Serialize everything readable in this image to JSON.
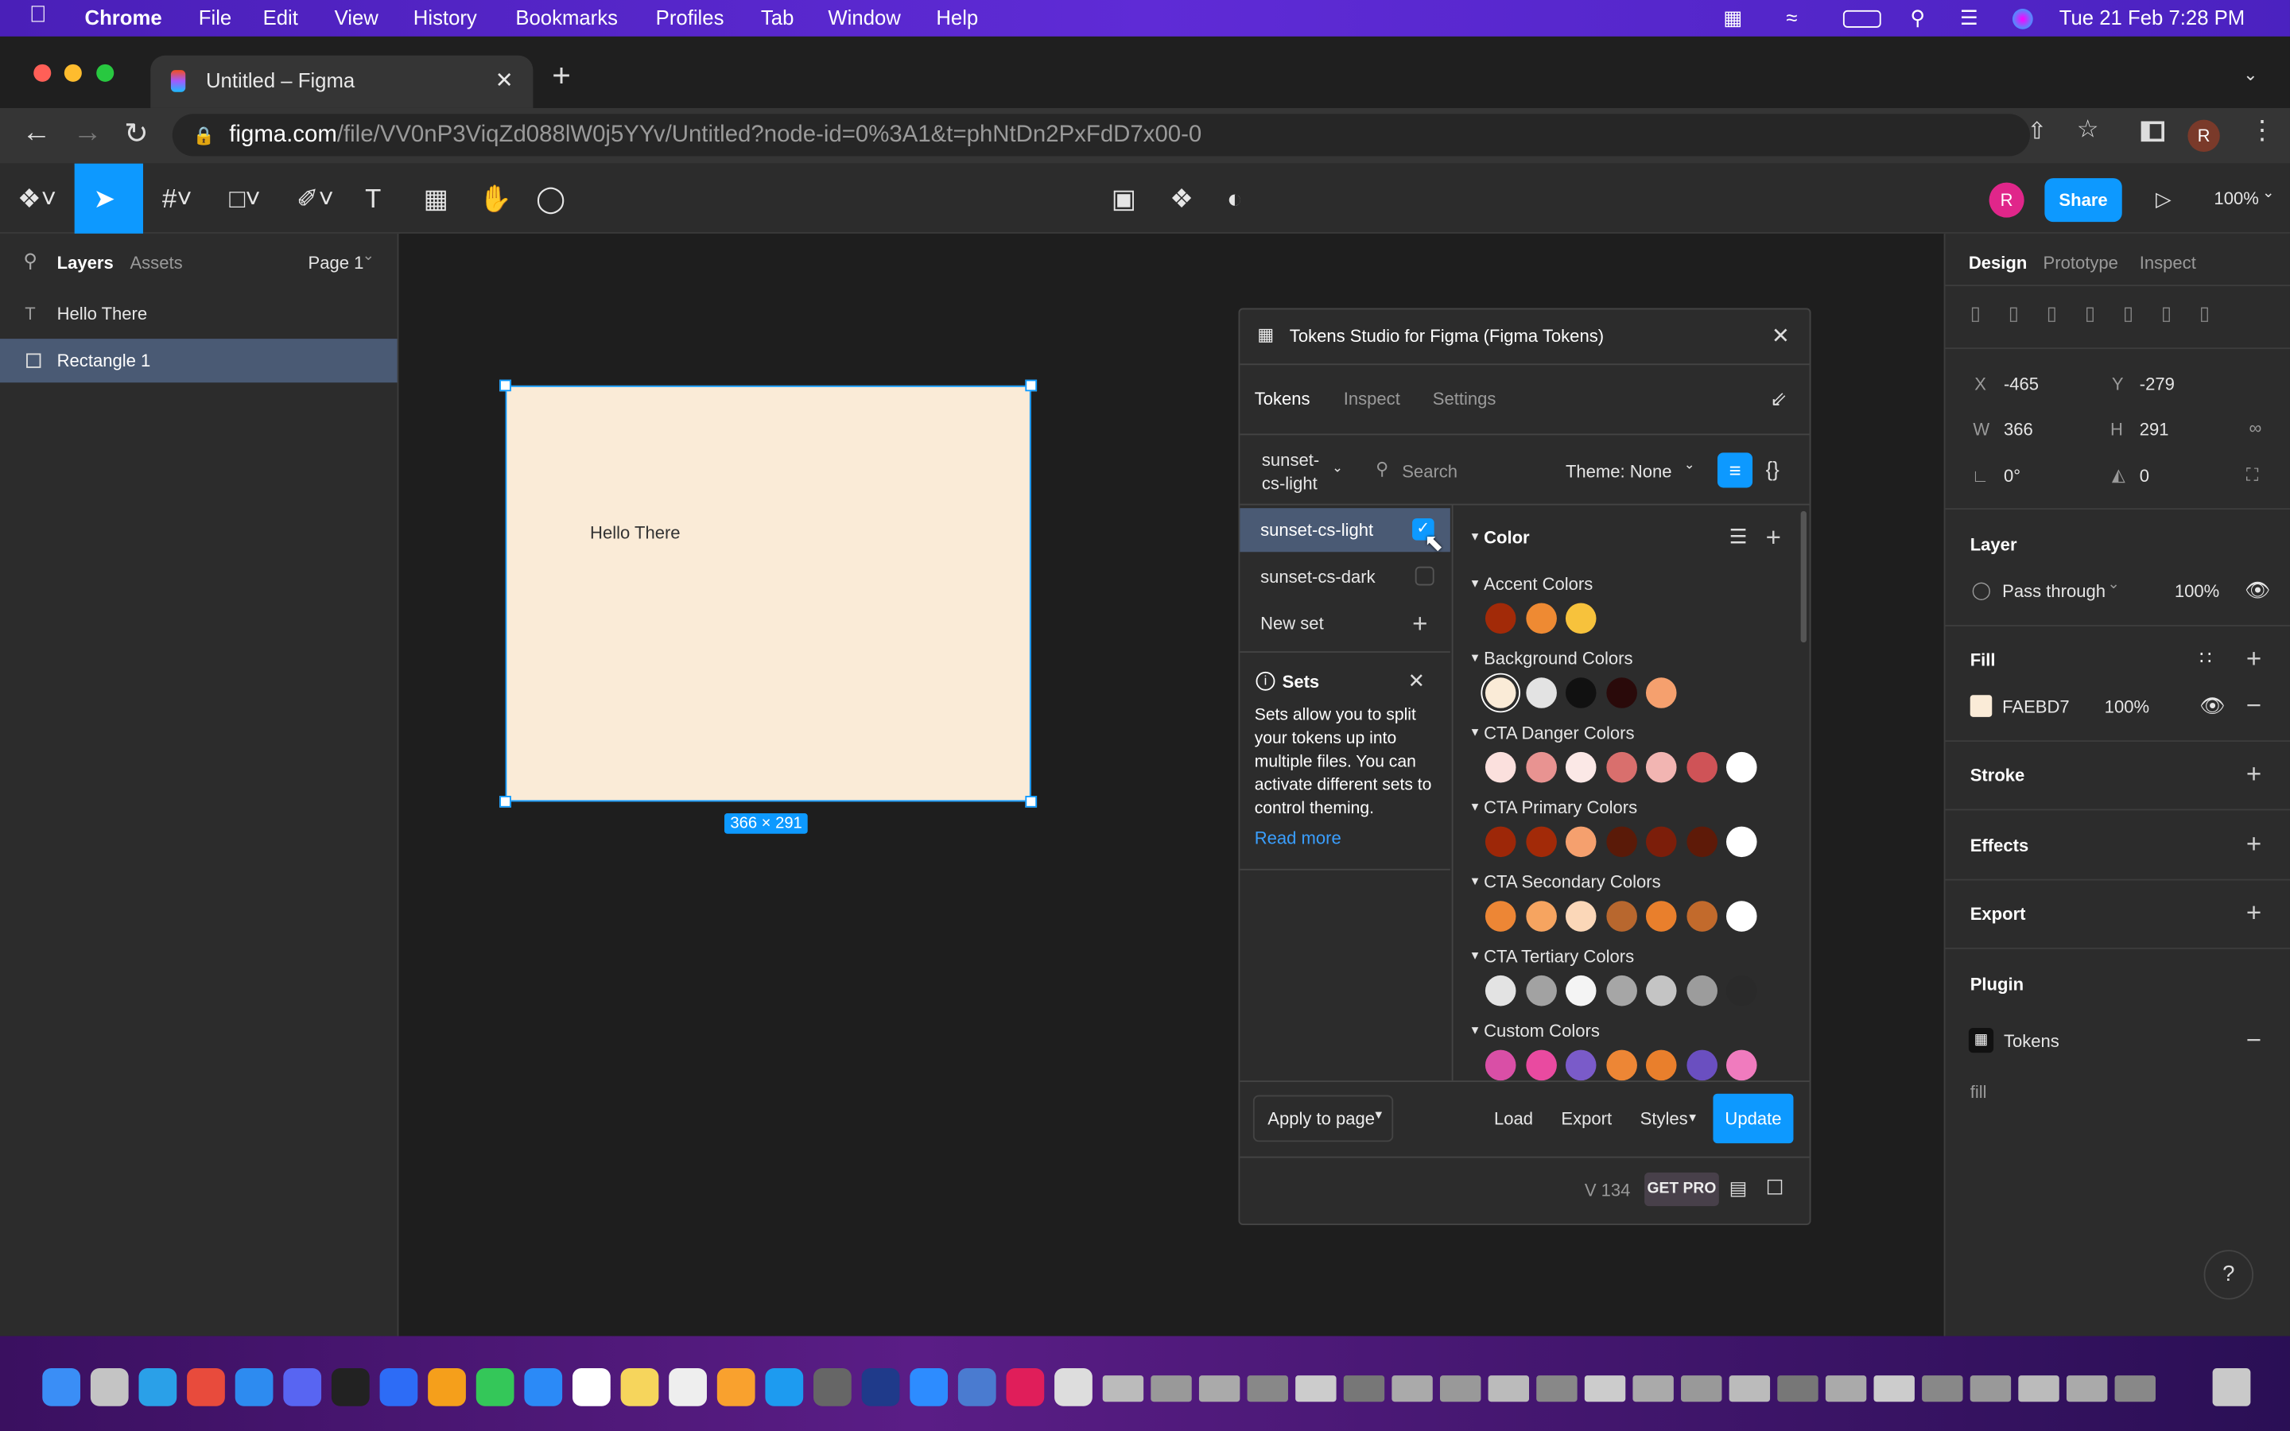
{
  "menubar": {
    "app": "Chrome",
    "items": [
      "File",
      "Edit",
      "View",
      "History",
      "Bookmarks",
      "Profiles",
      "Tab",
      "Window",
      "Help"
    ],
    "clock": "Tue 21 Feb  7:28 PM"
  },
  "browser": {
    "tab_title": "Untitled – Figma",
    "url_host": "figma.com",
    "url_path": "/file/VV0nP3ViqZd088lW0j5YYv/Untitled?node-id=0%3A1&t=phNtDn2PxFdD7x00-0",
    "profile_initial": "R"
  },
  "figma_toolbar": {
    "avatar": "R",
    "share_label": "Share",
    "zoom": "100%"
  },
  "left_panel": {
    "tabs": [
      "Layers",
      "Assets"
    ],
    "page": "Page 1",
    "layers": [
      {
        "name": "Hello There",
        "type": "text"
      },
      {
        "name": "Rectangle 1",
        "type": "rect",
        "selected": true
      }
    ]
  },
  "canvas": {
    "frame_text": "Hello There",
    "size_badge": "366 × 291",
    "frame_color": "#FAEBD7"
  },
  "plugin": {
    "title": "Tokens Studio for Figma (Figma Tokens)",
    "tabs": [
      "Tokens",
      "Inspect",
      "Settings"
    ],
    "set_selector": "sunset-cs-light",
    "search_placeholder": "Search",
    "theme": "Theme: None",
    "sets": [
      {
        "name": "sunset-cs-light",
        "active": true
      },
      {
        "name": "sunset-cs-dark",
        "active": false
      }
    ],
    "new_set": "New set",
    "sets_info": {
      "title": "Sets",
      "body": "Sets allow you to split your tokens up into multiple files. You can activate different sets to control theming.",
      "link": "Read more"
    },
    "section": "Color",
    "groups": [
      {
        "name": "Accent Colors",
        "colors": [
          "#A22A08",
          "#EE8A33",
          "#F7C23C"
        ]
      },
      {
        "name": "Background Colors",
        "colors": [
          "#FAEBD7",
          "#E3E3E3",
          "#111111",
          "#2A0A0A",
          "#F5A06E"
        ]
      },
      {
        "name": "CTA Danger Colors",
        "colors": [
          "#FBE0DD",
          "#E89391",
          "#FBE8E6",
          "#D96F6D",
          "#F2B5B2",
          "#CF5357",
          "#FFFFFF"
        ]
      },
      {
        "name": "CTA Primary Colors",
        "colors": [
          "#9D2708",
          "#A22A08",
          "#F5A06E",
          "#5A1A08",
          "#7C1E0A",
          "#5E1A08",
          "#FFFFFF"
        ]
      },
      {
        "name": "CTA Secondary Colors",
        "colors": [
          "#ED8635",
          "#F6A460",
          "#FBD7B8",
          "#B8672E",
          "#E97F2C",
          "#C26A2C",
          "#FFFFFF"
        ]
      },
      {
        "name": "CTA Tertiary Colors",
        "colors": [
          "#E3E3E3",
          "#A2A2A2",
          "#F4F4F4",
          "#A6A6A6",
          "#C4C4C4",
          "#9C9C9C",
          "#2A2A2A"
        ]
      },
      {
        "name": "Custom Colors",
        "colors": [
          "#D94FA6",
          "#E94AA0",
          "#7A5BC9",
          "#ED8635",
          "#E97F2C",
          "#6A4FC0",
          "#F07BBE"
        ]
      }
    ],
    "footer": {
      "apply": "Apply to page",
      "load": "Load",
      "export": "Export",
      "styles": "Styles",
      "update": "Update",
      "version": "V 134",
      "get_pro": "GET PRO"
    }
  },
  "right_panel": {
    "tabs": [
      "Design",
      "Prototype",
      "Inspect"
    ],
    "x_label": "X",
    "x": "-465",
    "y_label": "Y",
    "y": "-279",
    "w_label": "W",
    "w": "366",
    "h_label": "H",
    "h": "291",
    "rotation": "0°",
    "radius": "0",
    "layer_title": "Layer",
    "blend": "Pass through",
    "opacity": "100%",
    "fill_title": "Fill",
    "fill_hex": "FAEBD7",
    "fill_opacity": "100%",
    "stroke_title": "Stroke",
    "effects_title": "Effects",
    "export_title": "Export",
    "plugin_title": "Plugin",
    "plugin_name": "Tokens",
    "plugin_fill": "fill"
  }
}
